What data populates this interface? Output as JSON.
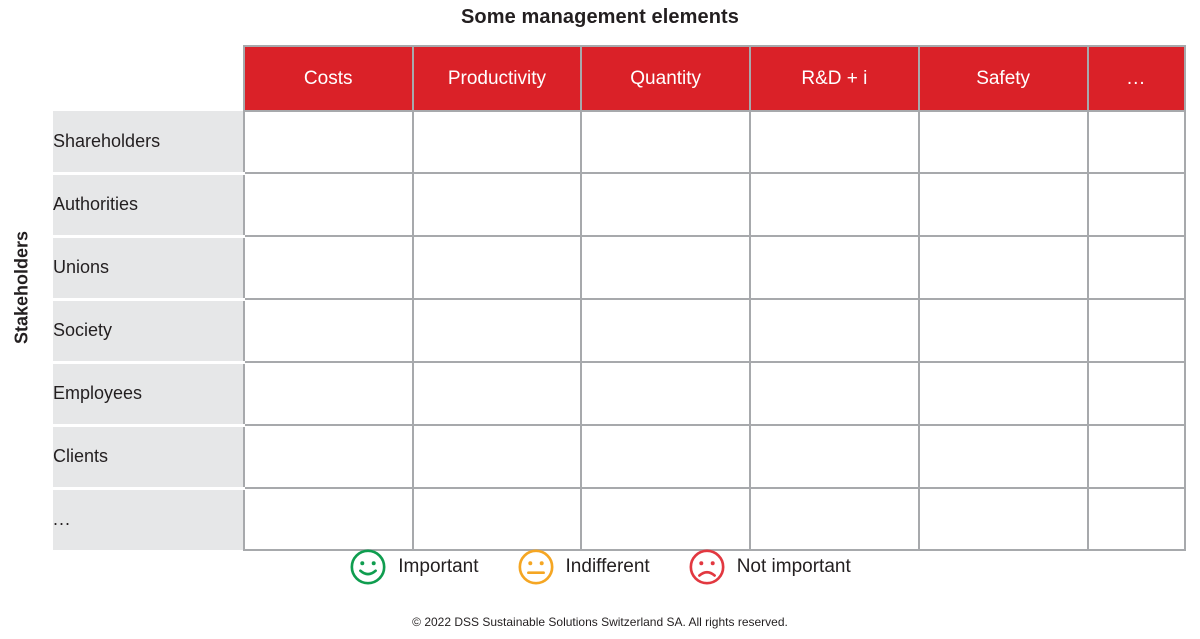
{
  "title": "Some management elements",
  "axis": {
    "y_label": "Stakeholders"
  },
  "colors": {
    "header_red": "#da2128",
    "row_label_gray": "#e6e7e8",
    "grid_gray": "#a7a9ac",
    "important_green": "#0f9d4f",
    "indifferent_orange": "#f5a623",
    "not_important_red": "#e23840",
    "text": "#231f20"
  },
  "smiley_key": [
    {
      "name": "smiley-happy-icon",
      "mood": "happy",
      "color": "#0f9d4f"
    },
    {
      "name": "smiley-neutral-icon",
      "mood": "neutral",
      "color": "#f5a623"
    },
    {
      "name": "smiley-sad-icon",
      "mood": "sad",
      "color": "#e23840"
    }
  ],
  "table": {
    "columns": [
      "Costs",
      "Productivity",
      "Quantity",
      "R&D + i",
      "Safety",
      "..."
    ],
    "rows": [
      {
        "label": "Shareholders",
        "values": [
          "",
          "",
          "",
          "",
          "",
          ""
        ]
      },
      {
        "label": "Authorities",
        "values": [
          "",
          "",
          "",
          "",
          "",
          ""
        ]
      },
      {
        "label": "Unions",
        "values": [
          "",
          "",
          "",
          "",
          "",
          ""
        ]
      },
      {
        "label": "Society",
        "values": [
          "",
          "",
          "",
          "",
          "",
          ""
        ]
      },
      {
        "label": "Employees",
        "values": [
          "",
          "",
          "",
          "",
          "",
          ""
        ]
      },
      {
        "label": "Clients",
        "values": [
          "",
          "",
          "",
          "",
          "",
          ""
        ]
      },
      {
        "label": "...",
        "values": [
          "",
          "",
          "",
          "",
          "",
          ""
        ]
      }
    ]
  },
  "legend": [
    {
      "label": "Important",
      "mood": "happy",
      "color": "#0f9d4f"
    },
    {
      "label": "Indifferent",
      "mood": "neutral",
      "color": "#f5a623"
    },
    {
      "label": "Not important",
      "mood": "sad",
      "color": "#e23840"
    }
  ],
  "footer": "© 2022 DSS Sustainable Solutions Switzerland SA. All rights reserved.",
  "chart_data": {
    "type": "table",
    "title": "Some management elements",
    "xlabel": "Some management elements",
    "ylabel": "Stakeholders",
    "categories": [
      "Costs",
      "Productivity",
      "Quantity",
      "R&D + i",
      "Safety",
      "..."
    ],
    "row_categories": [
      "Shareholders",
      "Authorities",
      "Unions",
      "Society",
      "Employees",
      "Clients",
      "..."
    ],
    "cells": [
      [
        "",
        "",
        "",
        "",
        "",
        ""
      ],
      [
        "",
        "",
        "",
        "",
        "",
        ""
      ],
      [
        "",
        "",
        "",
        "",
        "",
        ""
      ],
      [
        "",
        "",
        "",
        "",
        "",
        ""
      ],
      [
        "",
        "",
        "",
        "",
        "",
        ""
      ],
      [
        "",
        "",
        "",
        "",
        "",
        ""
      ],
      [
        "",
        "",
        "",
        "",
        "",
        ""
      ]
    ],
    "legend_entries": [
      "Important",
      "Indifferent",
      "Not important"
    ],
    "legend_position": "bottom",
    "grid": true,
    "note": "Blank stakeholder-vs-management-element prioritisation matrix; cells to be filled with one of three smiley ratings."
  }
}
